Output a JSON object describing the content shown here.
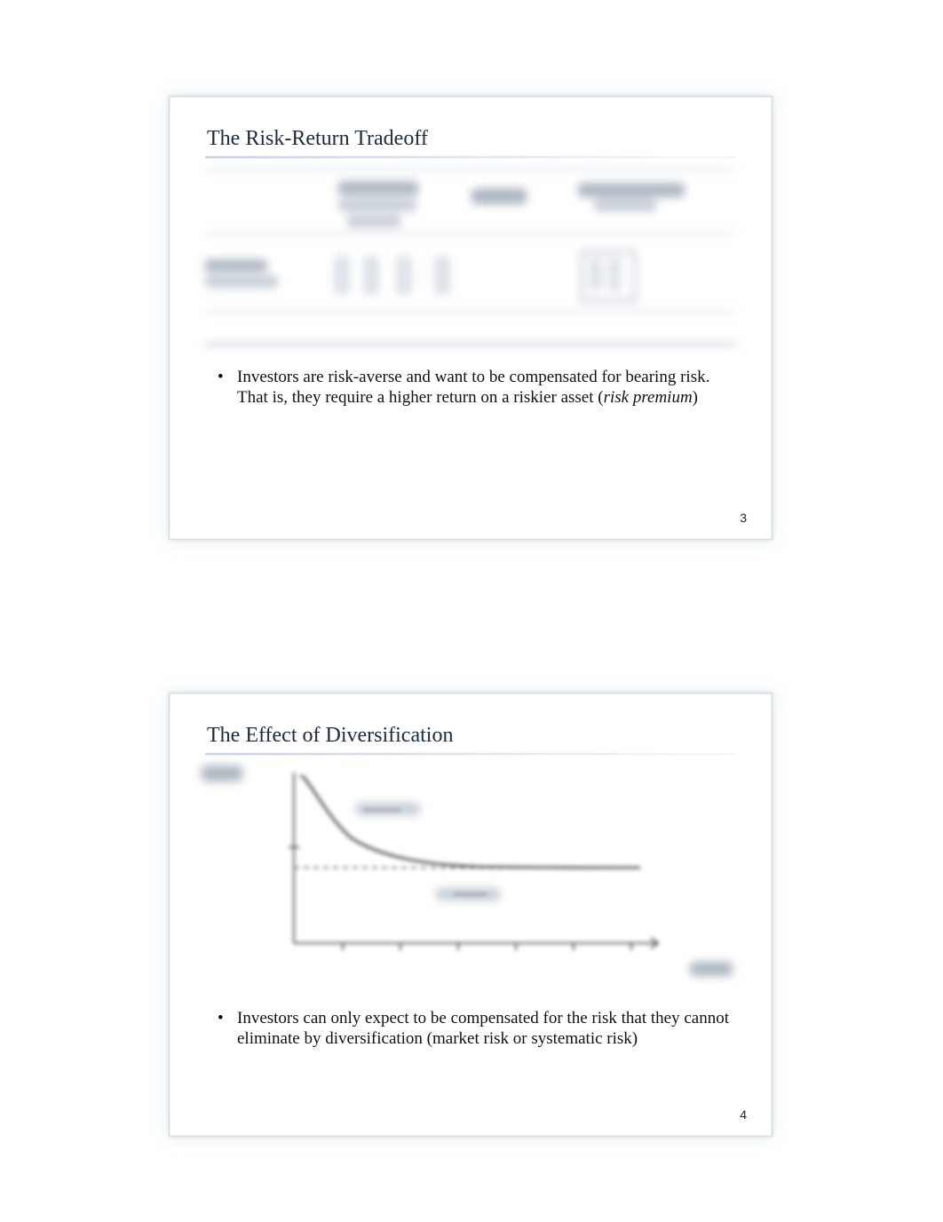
{
  "slides": [
    {
      "title": "The Risk-Return Tradeoff",
      "bullet_prefix": "Investors are risk-averse and want to be compensated for bearing risk. That is, they require a higher return on a riskier asset (",
      "bullet_italic": "risk premium",
      "bullet_suffix": ")",
      "page_number": "3"
    },
    {
      "title": "The Effect of Diversification",
      "bullet": "Investors can only expect to be compensated for the risk that they cannot eliminate by diversification (market risk or systematic risk)",
      "page_number": "4"
    }
  ],
  "chart_data": [
    {
      "type": "table",
      "note": "blurred table of asset-class risk/return; values illegible"
    },
    {
      "type": "line",
      "title": "",
      "xlabel": "Number of stocks",
      "ylabel": "Standard deviation",
      "series": [
        {
          "name": "Unique risk (diversifiable)",
          "x": [
            1,
            2,
            3,
            5,
            8,
            12,
            18,
            25,
            35,
            50
          ],
          "values": [
            48,
            38,
            32,
            27,
            24,
            22,
            21,
            20.5,
            20.2,
            20
          ]
        },
        {
          "name": "Market risk (systematic)",
          "x": [
            1,
            50
          ],
          "values": [
            20,
            20
          ]
        }
      ],
      "xlim": [
        0,
        50
      ],
      "ylim": [
        0,
        50
      ]
    }
  ]
}
